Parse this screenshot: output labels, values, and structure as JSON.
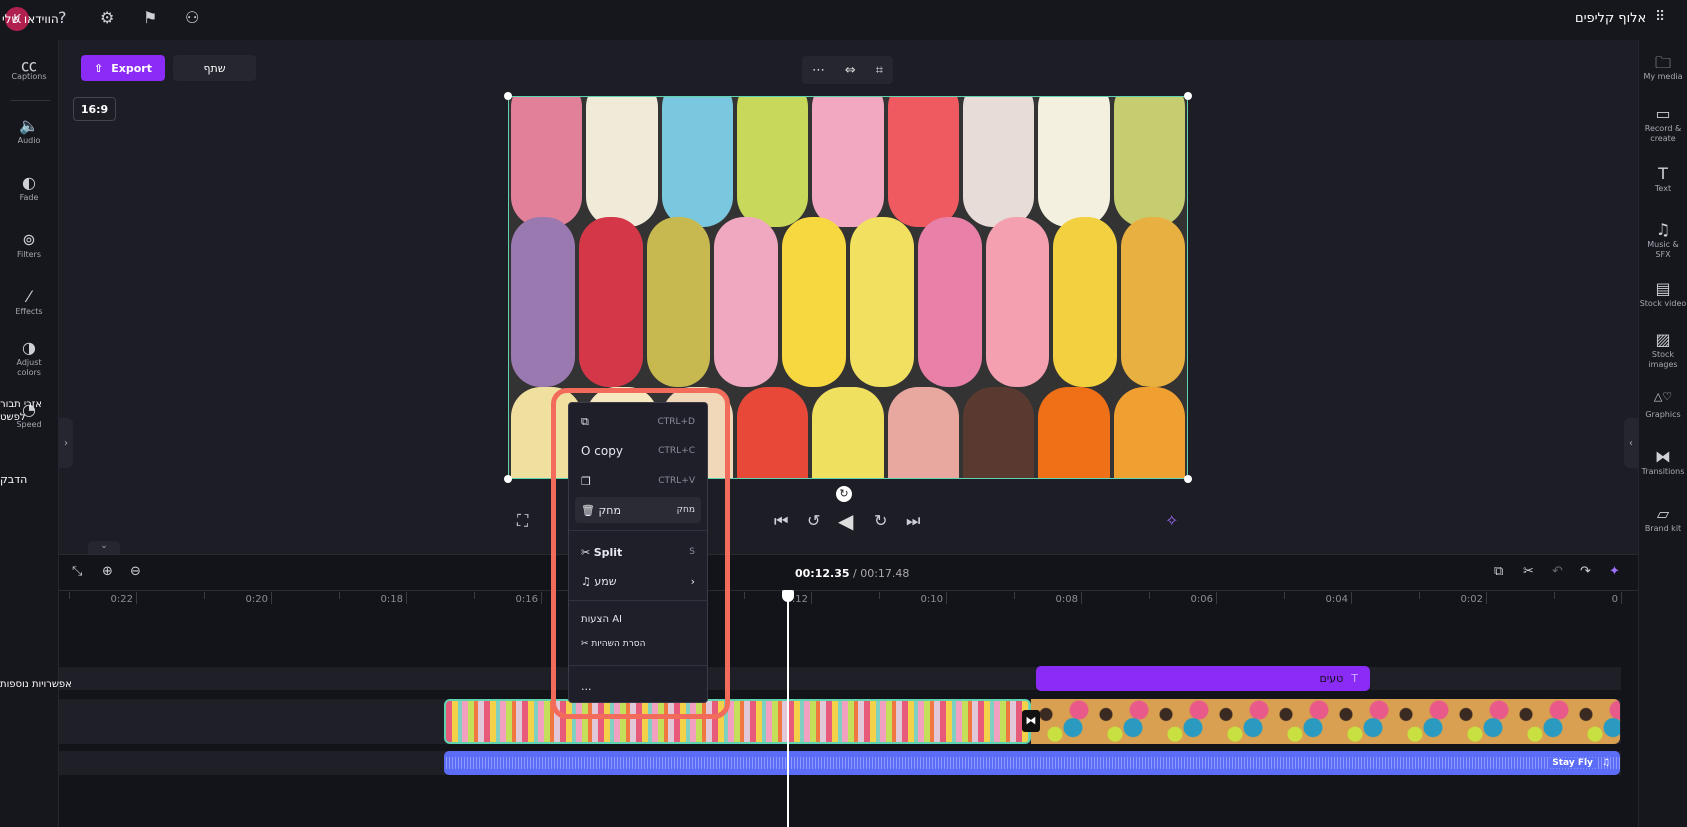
{
  "topbar": {
    "app_title": "אלוף קליפים",
    "my_videos": "הווידאו שלי",
    "avatar_initial": "K",
    "help": "?",
    "grid_icon": "apps-grid-icon"
  },
  "actions": {
    "export_label": "Export",
    "share_label": "שתף",
    "aspect_ratio": "16:9"
  },
  "left_sidebar": [
    {
      "label": "Captions",
      "icon": "captions-icon"
    },
    {
      "label": "Audio",
      "icon": "audio-icon"
    },
    {
      "label": "Fade",
      "icon": "fade-icon"
    },
    {
      "label": "Filters",
      "icon": "filters-icon"
    },
    {
      "label": "Effects",
      "icon": "effects-icon"
    },
    {
      "label": "Adjust colors",
      "icon": "adjust-colors-icon"
    },
    {
      "label": "Speed",
      "icon": "speed-icon"
    }
  ],
  "left_overlay": {
    "speed_text": "אזרי תבור לפשט",
    "paste_text": "הדבק"
  },
  "right_sidebar": [
    {
      "label": "My media"
    },
    {
      "label": "Record & create"
    },
    {
      "label": "Text"
    },
    {
      "label": "Music & SFX"
    },
    {
      "label": "Stock video"
    },
    {
      "label": "Stock images"
    },
    {
      "label": "Graphics"
    },
    {
      "label": "Transitions"
    },
    {
      "label": "Brand kit"
    }
  ],
  "timeline": {
    "current_time": "00:12.35",
    "total_time": "/ 00:17.48",
    "ticks": [
      "0",
      "0:02",
      "0:04",
      "0:06",
      "0:08",
      "0:10",
      "0:12",
      "0:14",
      "0:16",
      "0:18",
      "0:20",
      "0:22"
    ],
    "playhead_seconds": 12.35,
    "more_options": "אפשרויות נוספות",
    "text_clip": "טעים",
    "audio_clip": "Stay Fly"
  },
  "context_menu": {
    "duplicate_shortcut": "CTRL+D",
    "copy_label": "O copy",
    "copy_shortcut": "CTRL+C",
    "paste_shortcut": "CTRL+V",
    "delete_label": "מחק",
    "delete_shortcut": "מחק",
    "split_label": "Split",
    "split_shortcut": "S",
    "audio_label": "שמע",
    "ai_header": "הצעות AI",
    "noise_label": "הסרת השהיות",
    "more_label": "..."
  },
  "colors": {
    "accent": "#8a2cf6",
    "highlight": "#f26b5b",
    "audio": "#5b6cf6",
    "clip_border": "#5fd3b0"
  }
}
